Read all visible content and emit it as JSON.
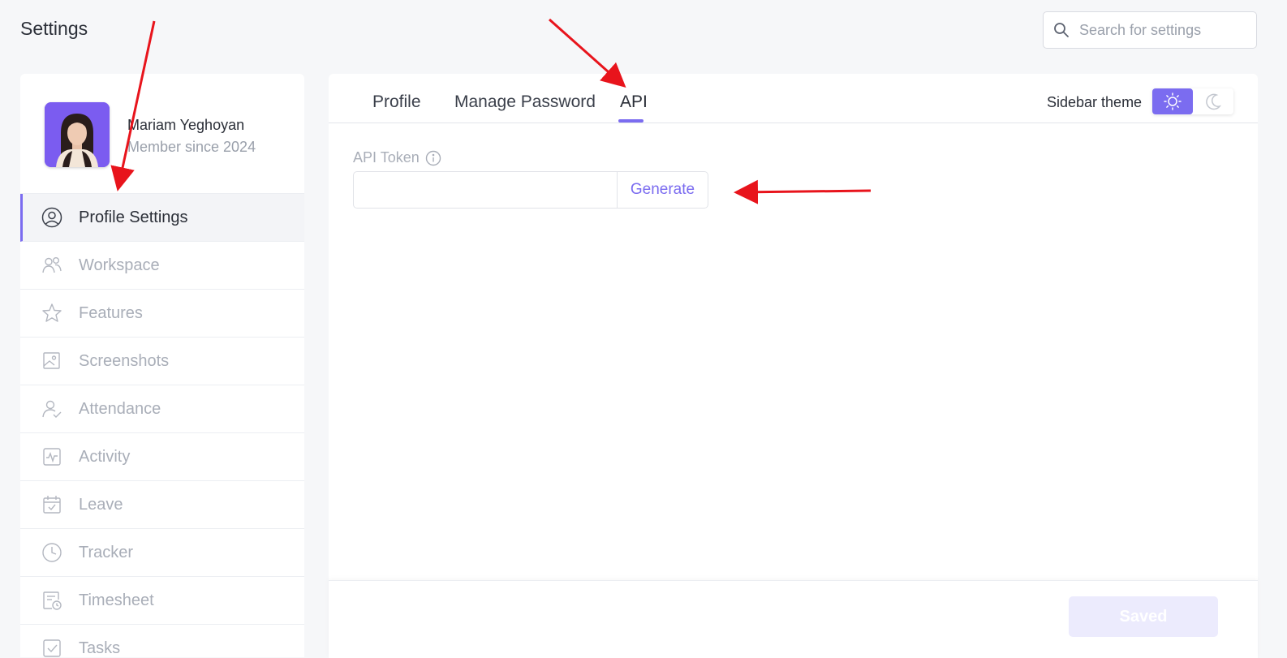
{
  "page": {
    "title": "Settings"
  },
  "search": {
    "placeholder": "Search for settings"
  },
  "profile": {
    "name": "Mariam Yeghoyan",
    "member_since": "Member since 2024"
  },
  "sidebar": {
    "items": [
      {
        "label": "Profile Settings",
        "icon": "user-circle-icon",
        "active": true
      },
      {
        "label": "Workspace",
        "icon": "users-icon"
      },
      {
        "label": "Features",
        "icon": "star-icon"
      },
      {
        "label": "Screenshots",
        "icon": "image-icon"
      },
      {
        "label": "Attendance",
        "icon": "user-check-icon"
      },
      {
        "label": "Activity",
        "icon": "activity-icon"
      },
      {
        "label": "Leave",
        "icon": "calendar-check-icon"
      },
      {
        "label": "Tracker",
        "icon": "clock-icon"
      },
      {
        "label": "Timesheet",
        "icon": "timesheet-icon"
      },
      {
        "label": "Tasks",
        "icon": "task-check-icon"
      }
    ]
  },
  "tabs": [
    {
      "label": "Profile"
    },
    {
      "label": "Manage Password"
    },
    {
      "label": "API",
      "active": true
    }
  ],
  "theme": {
    "label": "Sidebar theme",
    "selected": "light"
  },
  "api": {
    "token_label": "API Token",
    "token_value": "",
    "generate_label": "Generate"
  },
  "footer": {
    "save_label": "Saved"
  },
  "colors": {
    "accent": "#7b6cf0",
    "annotation_arrow": "#e8141c",
    "muted_text": "#a9aeb8"
  }
}
